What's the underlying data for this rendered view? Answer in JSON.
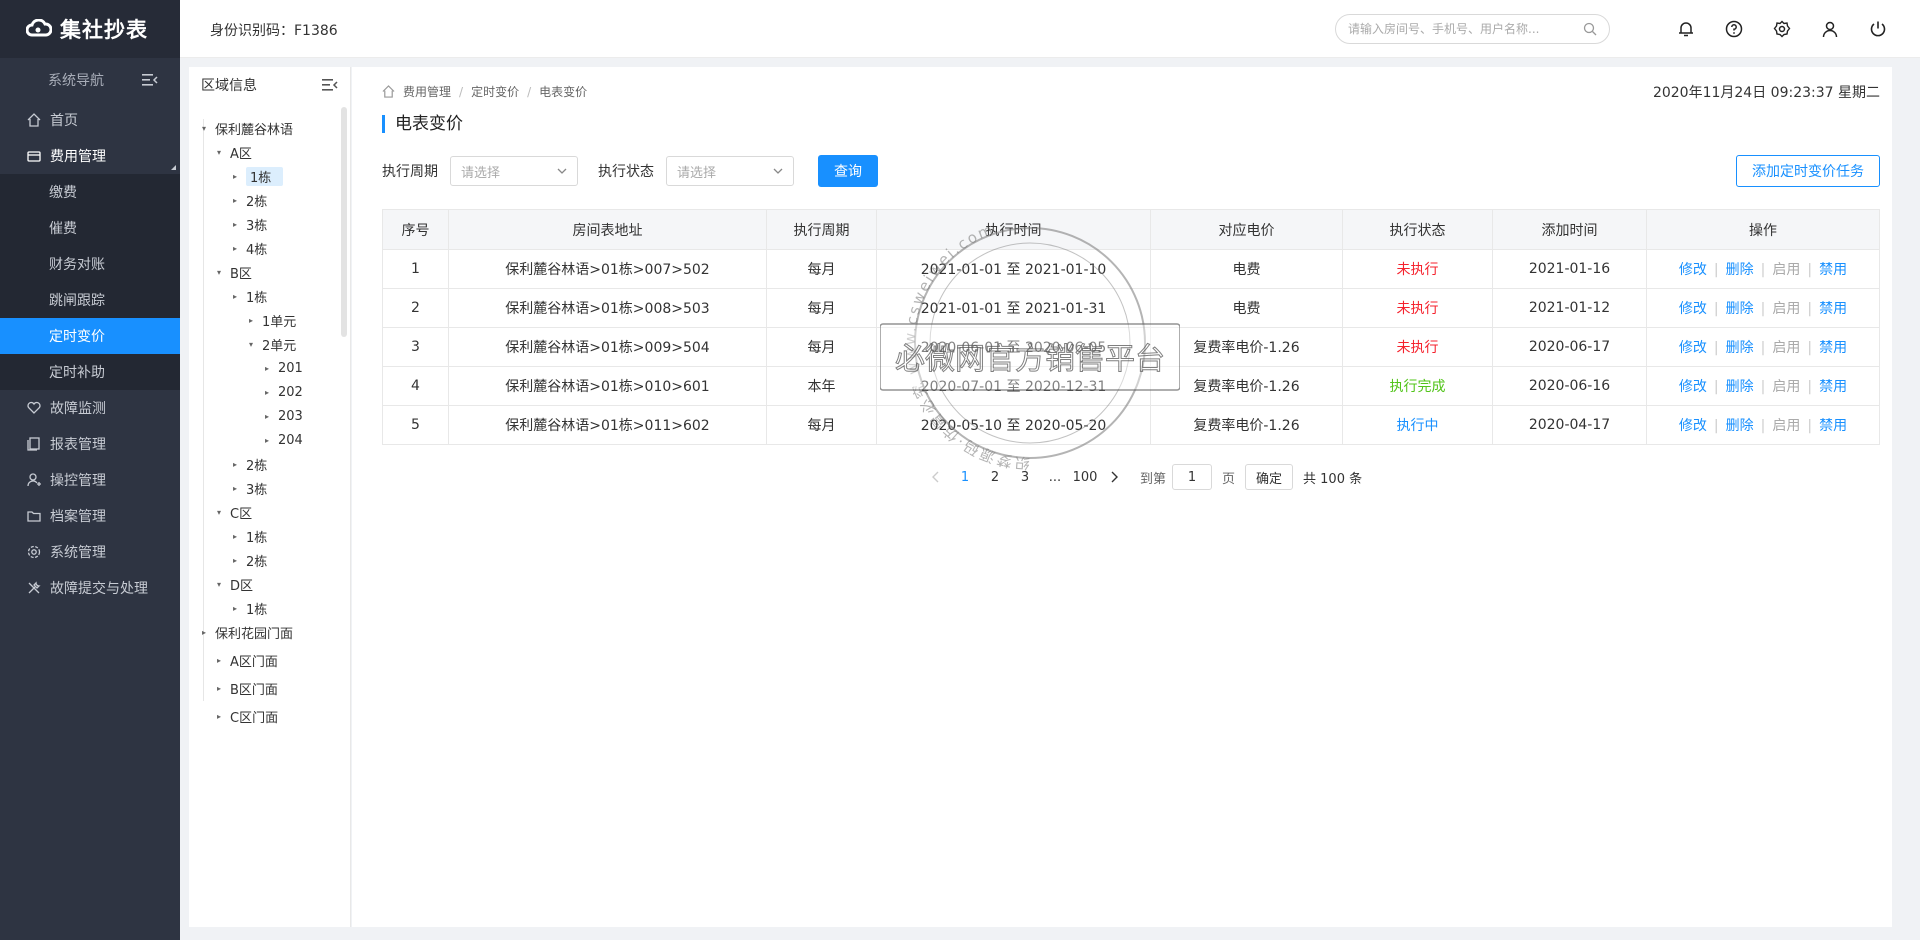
{
  "app": {
    "logo_text": "集社抄表"
  },
  "header": {
    "id_code": "身份识别码：F1386",
    "search_placeholder": "请输入房间号、手机号、用户名称..."
  },
  "sidebar": {
    "nav_title": "系统导航",
    "items": [
      {
        "label": "首页",
        "icon": "home-icon"
      },
      {
        "label": "费用管理",
        "icon": "money-icon"
      },
      {
        "label": "故障监测",
        "icon": "monitor-icon"
      },
      {
        "label": "报表管理",
        "icon": "report-icon"
      },
      {
        "label": "操控管理",
        "icon": "user-control-icon"
      },
      {
        "label": "档案管理",
        "icon": "folder-icon"
      },
      {
        "label": "系统管理",
        "icon": "gear-icon"
      },
      {
        "label": "故障提交与处理",
        "icon": "tools-icon"
      }
    ],
    "sub_items": [
      "缴费",
      "催费",
      "财务对账",
      "跳闸跟踪",
      "定时变价",
      "定时补助"
    ]
  },
  "tree": {
    "title": "区域信息",
    "nodes": [
      "保利麓谷林语",
      "A区",
      "1栋",
      "2栋",
      "3栋",
      "4栋",
      "B区",
      "1栋",
      "1单元",
      "2单元",
      "201",
      "202",
      "203",
      "204",
      "2栋",
      "3栋",
      "C区",
      "1栋",
      "2栋",
      "D区",
      "1栋",
      "保利花园门面",
      "A区门面",
      "B区门面",
      "C区门面"
    ]
  },
  "breadcrumb": [
    "费用管理",
    "定时变价",
    "电表变价"
  ],
  "datetime": "2020年11月24日 09:23:37 星期二",
  "page_title": "电表变价",
  "filters": {
    "period_label": "执行周期",
    "period_placeholder": "请选择",
    "status_label": "执行状态",
    "status_placeholder": "请选择",
    "query_label": "查询",
    "add_label": "添加定时变价任务"
  },
  "table": {
    "headers": [
      "序号",
      "房间表地址",
      "执行周期",
      "执行时间",
      "对应电价",
      "执行状态",
      "添加时间",
      "操作"
    ],
    "rows": [
      {
        "no": "1",
        "address": "保利麓谷林语>01栋>007>502",
        "period": "每月",
        "time": "2021-01-01 至 2021-01-10",
        "price": "电费",
        "status": "未执行",
        "status_color": "#f5222d",
        "added": "2021-01-16"
      },
      {
        "no": "2",
        "address": "保利麓谷林语>01栋>008>503",
        "period": "每月",
        "time": "2021-01-01 至 2021-01-31",
        "price": "电费",
        "status": "未执行",
        "status_color": "#f5222d",
        "added": "2021-01-12"
      },
      {
        "no": "3",
        "address": "保利麓谷林语>01栋>009>504",
        "period": "每月",
        "time": "2020-06-01 至 2020-06-05",
        "price": "复费率电价-1.26",
        "status": "未执行",
        "status_color": "#f5222d",
        "added": "2020-06-17"
      },
      {
        "no": "4",
        "address": "保利麓谷林语>01栋>010>601",
        "period": "本年",
        "time": "2020-07-01 至 2020-12-31",
        "price": "复费率电价-1.26",
        "status": "执行完成",
        "status_color": "#52c41a",
        "added": "2020-06-16"
      },
      {
        "no": "5",
        "address": "保利麓谷林语>01栋>011>602",
        "period": "每月",
        "time": "2020-05-10 至 2020-05-20",
        "price": "复费率电价-1.26",
        "status": "执行中",
        "status_color": "#1890ff",
        "added": "2020-04-17"
      }
    ],
    "ops": [
      "修改",
      "删除",
      "启用",
      "禁用"
    ]
  },
  "pagination": {
    "pages": [
      "1",
      "2",
      "3",
      "...",
      "100"
    ],
    "goto_label": "到第",
    "goto_value": "1",
    "goto_unit": "页",
    "confirm_label": "确定",
    "total": "共 100 条"
  },
  "watermark": {
    "ring_text": "织梦源码·仿冒必究 www.csweiwei.com",
    "banner_text": "必微网官方销售平台"
  }
}
